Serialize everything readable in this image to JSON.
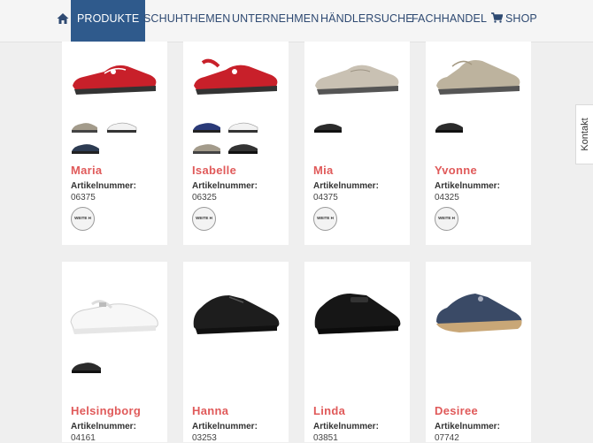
{
  "nav": {
    "items": [
      "PRODUKTE",
      "SCHUHTHEMEN",
      "UNTERNEHMEN",
      "HÄNDLERSUCHE",
      "FACHHANDEL",
      "SHOP"
    ],
    "active": "PRODUKTE"
  },
  "products": [
    {
      "name": "Maria",
      "label": "Artikelnummer:",
      "number": "06375",
      "badge": "WEITE H",
      "color": "#c8202a"
    },
    {
      "name": "Isabelle",
      "label": "Artikelnummer:",
      "number": "06325",
      "badge": "WEITE H",
      "color": "#c8202a"
    },
    {
      "name": "Mia",
      "label": "Artikelnummer:",
      "number": "04375",
      "badge": "WEITE H",
      "color": "#c9c1b3"
    },
    {
      "name": "Yvonne",
      "label": "Artikelnummer:",
      "number": "04325",
      "badge": "WEITE H",
      "color": "#bdb39e"
    },
    {
      "name": "Helsingborg",
      "label": "Artikelnummer:",
      "number": "04161"
    },
    {
      "name": "Hanna",
      "label": "Artikelnummer:",
      "number": "03253"
    },
    {
      "name": "Linda",
      "label": "Artikelnummer:",
      "number": "03851"
    },
    {
      "name": "Desiree",
      "label": "Artikelnummer:",
      "number": "07742"
    }
  ],
  "kontakt": "Kontakt"
}
